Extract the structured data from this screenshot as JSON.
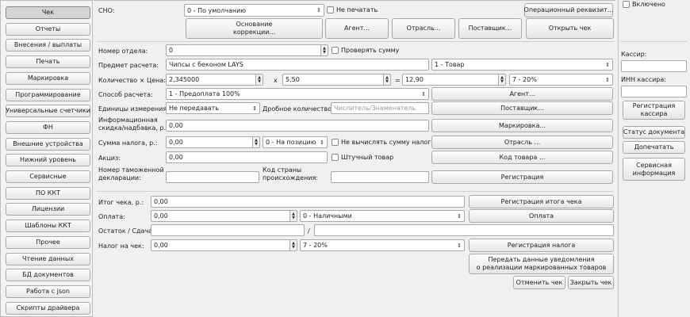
{
  "sidebar": {
    "items": [
      "Чек",
      "Отчеты",
      "Внесения / выплаты",
      "Печать",
      "Маркировка",
      "Программирование",
      "Универсальные счетчики",
      "ФН",
      "Внешние устройства",
      "Нижний уровень",
      "Сервисные",
      "ПО ККТ",
      "Лицензии",
      "Шаблоны ККТ",
      "Прочее",
      "Чтение данных",
      "БД документов",
      "Работа с json",
      "Скрипты драйвера"
    ],
    "selected": "Чек"
  },
  "top": {
    "sno_label": "СНО:",
    "sno_value": "0 - По умолчанию",
    "no_print": "Не печатать",
    "op_requisite": "Операционный реквизит...",
    "correction_basis": "Основание\nкоррекции...",
    "agent": "Агент...",
    "industry": "Отрасль...",
    "supplier": "Поставщик...",
    "open_receipt": "Открыть чек"
  },
  "item": {
    "dept_label": "Номер отдела:",
    "dept_value": "0",
    "check_sum": "Проверять сумму",
    "subject_label": "Предмет расчета:",
    "subject_value": "Чипсы с беконом LAYS",
    "subject_type": "1 - Товар",
    "qty_price_label": "Количество × Цена:",
    "qty_value": "2,345000",
    "times": "x",
    "price_value": "5,50",
    "equals": "=",
    "total_value": "12,90",
    "vat_value": "7 - 20%",
    "pay_method_label": "Способ расчета:",
    "pay_method_value": "1 - Предоплата 100%",
    "agent_btn": "Агент...",
    "units_label": "Единицы измерения:",
    "units_value": "Не передавать",
    "fraction_label": "Дробное количество:",
    "fraction_placeholder": "Числитель/Знаменатель",
    "supplier_btn": "Поставщик...",
    "info_label": "Информационная\nскидка/надбавка, р.:",
    "info_value": "0,00",
    "marking_btn": "Маркировка...",
    "tax_sum_label": "Сумма налога, р.:",
    "tax_sum_value": "0,00",
    "tax_mode": "0 - На позицию",
    "no_calc_tax": "Не вычислять сумму налога",
    "industry_btn": "Отрасль ...",
    "excise_label": "Акциз:",
    "excise_value": "0,00",
    "piece_goods": "Штучный товар",
    "product_code_btn": "Код товара ...",
    "customs_label": "Номер таможенной\nдекларации:",
    "country_label": "Код страны\nпроисхождения:",
    "register_btn": "Регистрация"
  },
  "totals": {
    "total_label": "Итог чека, р.:",
    "total_value": "0,00",
    "total_btn": "Регистрация итога чека",
    "payment_label": "Оплата:",
    "payment_value": "0,00",
    "payment_type": "0 - Наличными",
    "payment_btn": "Оплата",
    "change_label": "Остаток / Сдача:",
    "slash": "/",
    "tax_label": "Налог на чек:",
    "tax_value": "0,00",
    "tax_rate": "7 - 20%",
    "tax_btn": "Регистрация налога",
    "notify_btn": "Передать данные уведомления\nо реализации маркированных товаров",
    "cancel_btn": "Отменить чек",
    "close_btn": "Закрыть чек"
  },
  "right": {
    "enabled": "Включено",
    "cashier_label": "Кассир:",
    "inn_label": "ИНН кассира:",
    "register_cashier": "Регистрация\nкассира",
    "doc_status": "Статус документа",
    "reprint": "Допечатать",
    "service_info": "Сервисная\nинформация"
  }
}
